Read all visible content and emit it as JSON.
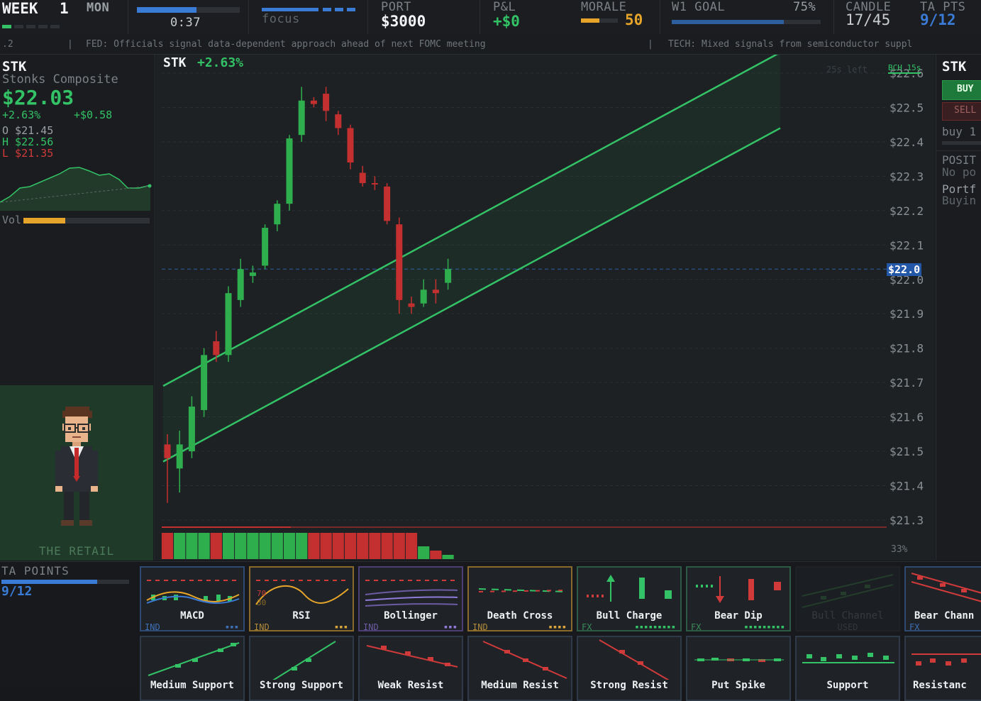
{
  "topbar": {
    "week_label": "WEEK",
    "week_num": "1",
    "day": "MON",
    "timer": "0:37",
    "timer_progress": 0.58,
    "focus_label": "focus",
    "port_label": "PORT",
    "port_value": "$3000",
    "pnl_label": "P&L",
    "pnl_value": "+$0",
    "morale_label": "MORALE",
    "morale_value": "50",
    "morale_level": 0.5,
    "goal_label": "W1 GOAL",
    "goal_pct": "75%",
    "goal_level": 0.75,
    "candle_label": "CANDLE",
    "candle_value": "17/45",
    "tapts_label": "TA PTS",
    "tapts_value": "9/12"
  },
  "ticker": {
    "prefix": ".2",
    "item1": "FED: Officials signal data-dependent approach ahead of next FOMC meeting",
    "item2": "TECH: Mixed signals from semiconductor suppl"
  },
  "left": {
    "symbol": "STK",
    "name": "Stonks Composite",
    "price": "$22.03",
    "change_pct": "+2.63%",
    "change_abs": "+$0.58",
    "open": "O $21.45",
    "high": "H $22.56",
    "low": "L $21.35",
    "vol_label": "Vol",
    "vol_level": 0.33,
    "character_caption": "THE RETAIL"
  },
  "chart": {
    "title_symbol": "STK",
    "title_change": "+2.63%",
    "time_left": "25s left",
    "bch_tag": "BCH 15s",
    "price_tag": "$22.0",
    "vol_pct": "33%"
  },
  "chart_data": {
    "type": "candlestick",
    "y_ticks": [
      "$22.6",
      "$22.5",
      "$22.4",
      "$22.3",
      "$22.2",
      "$22.1",
      "$22.0",
      "$21.9",
      "$21.8",
      "$21.7",
      "$21.6",
      "$21.5",
      "$21.4",
      "$21.3"
    ],
    "ylim": [
      21.3,
      22.6
    ],
    "current_price": 22.03,
    "candles": [
      {
        "o": 21.52,
        "h": 21.55,
        "l": 21.35,
        "c": 21.48,
        "color": "red"
      },
      {
        "o": 21.45,
        "h": 21.56,
        "l": 21.38,
        "c": 21.52,
        "color": "green"
      },
      {
        "o": 21.5,
        "h": 21.66,
        "l": 21.48,
        "c": 21.63,
        "color": "green"
      },
      {
        "o": 21.62,
        "h": 21.8,
        "l": 21.6,
        "c": 21.78,
        "color": "green"
      },
      {
        "o": 21.82,
        "h": 21.85,
        "l": 21.76,
        "c": 21.78,
        "color": "red"
      },
      {
        "o": 21.78,
        "h": 21.98,
        "l": 21.76,
        "c": 21.96,
        "color": "green"
      },
      {
        "o": 21.94,
        "h": 22.06,
        "l": 21.92,
        "c": 22.03,
        "color": "green"
      },
      {
        "o": 22.02,
        "h": 22.04,
        "l": 21.99,
        "c": 22.01,
        "color": "green"
      },
      {
        "o": 22.04,
        "h": 22.16,
        "l": 22.03,
        "c": 22.15,
        "color": "green"
      },
      {
        "o": 22.16,
        "h": 22.23,
        "l": 22.14,
        "c": 22.22,
        "color": "green"
      },
      {
        "o": 22.22,
        "h": 22.42,
        "l": 22.2,
        "c": 22.41,
        "color": "green"
      },
      {
        "o": 22.42,
        "h": 22.56,
        "l": 22.4,
        "c": 22.52,
        "color": "green"
      },
      {
        "o": 22.52,
        "h": 22.53,
        "l": 22.5,
        "c": 22.51,
        "color": "red"
      },
      {
        "o": 22.54,
        "h": 22.56,
        "l": 22.46,
        "c": 22.49,
        "color": "red"
      },
      {
        "o": 22.48,
        "h": 22.49,
        "l": 22.42,
        "c": 22.44,
        "color": "red"
      },
      {
        "o": 22.44,
        "h": 22.45,
        "l": 22.32,
        "c": 22.34,
        "color": "red"
      },
      {
        "o": 22.31,
        "h": 22.33,
        "l": 22.27,
        "c": 22.28,
        "color": "red"
      },
      {
        "o": 22.28,
        "h": 22.3,
        "l": 22.26,
        "c": 22.28,
        "color": "red"
      },
      {
        "o": 22.27,
        "h": 22.28,
        "l": 22.16,
        "c": 22.17,
        "color": "red"
      },
      {
        "o": 22.16,
        "h": 22.18,
        "l": 21.9,
        "c": 21.94,
        "color": "red"
      },
      {
        "o": 21.92,
        "h": 21.95,
        "l": 21.9,
        "c": 21.93,
        "color": "red"
      },
      {
        "o": 21.93,
        "h": 22.0,
        "l": 21.92,
        "c": 21.97,
        "color": "green"
      },
      {
        "o": 21.96,
        "h": 22.0,
        "l": 21.93,
        "c": 21.97,
        "color": "red"
      },
      {
        "o": 21.99,
        "h": 22.06,
        "l": 21.97,
        "c": 22.03,
        "color": "green"
      }
    ],
    "channel": {
      "lower_start": 21.47,
      "lower_end": 22.44,
      "upper_start": 21.69,
      "upper_end": 22.66
    }
  },
  "right": {
    "symbol": "STK",
    "buy_label": "BUY",
    "sell_label": "SELL",
    "buy_note": "buy 1",
    "pos_label": "POSIT",
    "pos_value": "No po",
    "port_label": "Portf",
    "port_value": "Buyin"
  },
  "bottom": {
    "ta_label": "TA POINTS",
    "ta_value": "9/12",
    "ta_level": 0.75,
    "cards_row1": [
      {
        "label": "MACD",
        "tag": "IND",
        "dots": "▪▪▪",
        "border": "#2f4a70",
        "tagcolor": "#3f6fb5",
        "dotcolor": "#3f6fb5"
      },
      {
        "label": "RSI",
        "tag": "IND",
        "dots": "▪▪▪",
        "border": "#8a6a2a",
        "tagcolor": "#b08a3a",
        "dotcolor": "#d9a43a"
      },
      {
        "label": "Bollinger",
        "tag": "IND",
        "dots": "▪▪▪",
        "border": "#4c3e72",
        "tagcolor": "#6c5ba3",
        "dotcolor": "#8f7ad9"
      },
      {
        "label": "Death Cross",
        "tag": "IND",
        "dots": "▪▪▪▪",
        "border": "#8a6a2a",
        "tagcolor": "#b08a3a",
        "dotcolor": "#d9a43a"
      },
      {
        "label": "Bull Charge",
        "tag": "FX",
        "dots": "▪▪▪▪▪▪▪▪▪",
        "border": "#2b5a45",
        "tagcolor": "#3a8a5a",
        "dotcolor": "#33c266"
      },
      {
        "label": "Bear Dip",
        "tag": "FX",
        "dots": "▪▪▪▪▪▪▪▪▪",
        "border": "#2b5a45",
        "tagcolor": "#3a8a5a",
        "dotcolor": "#33c266"
      },
      {
        "label": "Bull Channel",
        "tag": "USED",
        "dots": "",
        "border": "#262a2e",
        "tagcolor": "#4a5055",
        "dotcolor": "#4a5055"
      },
      {
        "label": "Bear Chann",
        "tag": "FX",
        "dots": "",
        "border": "#2f4a70",
        "tagcolor": "#3f6fb5",
        "dotcolor": "#3f6fb5"
      }
    ],
    "cards_row2": [
      {
        "label": "Medium Support"
      },
      {
        "label": "Strong Support"
      },
      {
        "label": "Weak Resist"
      },
      {
        "label": "Medium Resist"
      },
      {
        "label": "Strong Resist"
      },
      {
        "label": "Put Spike"
      },
      {
        "label": "Support"
      },
      {
        "label": "Resistanc"
      }
    ]
  }
}
